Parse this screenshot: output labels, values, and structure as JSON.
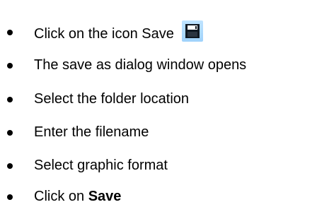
{
  "instructions": {
    "items": [
      {
        "text": "Click on the icon Save",
        "icon": "save-icon"
      },
      {
        "text": "The save as dialog window opens"
      },
      {
        "text": "Select the folder location"
      },
      {
        "text": "Enter the filename"
      },
      {
        "text": "Select graphic format"
      },
      {
        "text_prefix": "Click on ",
        "bold_text": "Save"
      }
    ]
  }
}
